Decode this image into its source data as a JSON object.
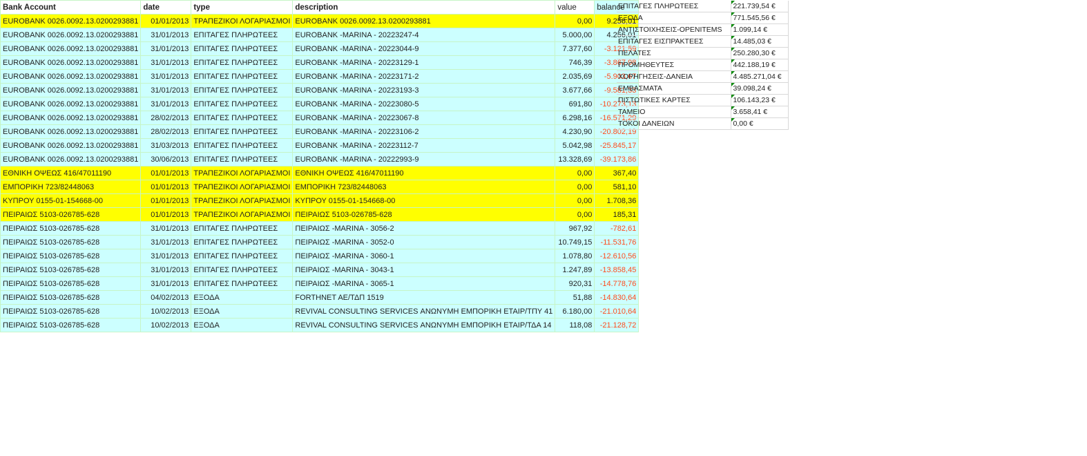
{
  "headers": {
    "account": "Bank Account",
    "date": "date",
    "type": "type",
    "description": "description",
    "value": "value",
    "balance": "balance"
  },
  "rows": [
    {
      "account": "EUROBANK 0026.0092.13.0200293881",
      "date": "01/01/2013",
      "type": "ΤΡΑΠΕΖΙΚΟΙ ΛΟΓΑΡΙΑΣΜΟΙ",
      "description": "EUROBANK 0026.0092.13.0200293881",
      "value": "0,00",
      "balance": "9.256,01",
      "highlight": true
    },
    {
      "account": "EUROBANK 0026.0092.13.0200293881",
      "date": "31/01/2013",
      "type": "ΕΠΙΤΑΓΕΣ ΠΛΗΡΩΤΕΕΣ",
      "description": "EUROBANK -MARINA - 20223247-4",
      "value": "5.000,00",
      "balance": "4.256,01"
    },
    {
      "account": "EUROBANK 0026.0092.13.0200293881",
      "date": "31/01/2013",
      "type": "ΕΠΙΤΑΓΕΣ ΠΛΗΡΩΤΕΕΣ",
      "description": "EUROBANK -MARINA - 20223044-9",
      "value": "7.377,60",
      "balance": "-3.121,59"
    },
    {
      "account": "EUROBANK 0026.0092.13.0200293881",
      "date": "31/01/2013",
      "type": "ΕΠΙΤΑΓΕΣ ΠΛΗΡΩΤΕΕΣ",
      "description": "EUROBANK -MARINA - 20223129-1",
      "value": "746,39",
      "balance": "-3.867,98"
    },
    {
      "account": "EUROBANK 0026.0092.13.0200293881",
      "date": "31/01/2013",
      "type": "ΕΠΙΤΑΓΕΣ ΠΛΗΡΩΤΕΕΣ",
      "description": "EUROBANK -MARINA - 20223171-2",
      "value": "2.035,69",
      "balance": "-5.903,67"
    },
    {
      "account": "EUROBANK 0026.0092.13.0200293881",
      "date": "31/01/2013",
      "type": "ΕΠΙΤΑΓΕΣ ΠΛΗΡΩΤΕΕΣ",
      "description": "EUROBANK -MARINA - 20223193-3",
      "value": "3.677,66",
      "balance": "-9.581,33"
    },
    {
      "account": "EUROBANK 0026.0092.13.0200293881",
      "date": "31/01/2013",
      "type": "ΕΠΙΤΑΓΕΣ ΠΛΗΡΩΤΕΕΣ",
      "description": "EUROBANK -MARINA - 20223080-5",
      "value": "691,80",
      "balance": "-10.273,13"
    },
    {
      "account": "EUROBANK 0026.0092.13.0200293881",
      "date": "28/02/2013",
      "type": "ΕΠΙΤΑΓΕΣ ΠΛΗΡΩΤΕΕΣ",
      "description": "EUROBANK -MARINA - 20223067-8",
      "value": "6.298,16",
      "balance": "-16.571,29"
    },
    {
      "account": "EUROBANK 0026.0092.13.0200293881",
      "date": "28/02/2013",
      "type": "ΕΠΙΤΑΓΕΣ ΠΛΗΡΩΤΕΕΣ",
      "description": "EUROBANK -MARINA - 20223106-2",
      "value": "4.230,90",
      "balance": "-20.802,19"
    },
    {
      "account": "EUROBANK 0026.0092.13.0200293881",
      "date": "31/03/2013",
      "type": "ΕΠΙΤΑΓΕΣ ΠΛΗΡΩΤΕΕΣ",
      "description": "EUROBANK -MARINA - 20223112-7",
      "value": "5.042,98",
      "balance": "-25.845,17"
    },
    {
      "account": "EUROBANK 0026.0092.13.0200293881",
      "date": "30/06/2013",
      "type": "ΕΠΙΤΑΓΕΣ ΠΛΗΡΩΤΕΕΣ",
      "description": "EUROBANK -MARINA - 20222993-9",
      "value": "13.328,69",
      "balance": "-39.173,86"
    },
    {
      "account": "ΕΘΝΙΚΗ ΟΨΕΩΣ 416/47011190",
      "date": "01/01/2013",
      "type": "ΤΡΑΠΕΖΙΚΟΙ ΛΟΓΑΡΙΑΣΜΟΙ",
      "description": "ΕΘΝΙΚΗ ΟΨΕΩΣ 416/47011190",
      "value": "0,00",
      "balance": "367,40",
      "highlight": true
    },
    {
      "account": "ΕΜΠΟΡΙΚΗ 723/82448063",
      "date": "01/01/2013",
      "type": "ΤΡΑΠΕΖΙΚΟΙ ΛΟΓΑΡΙΑΣΜΟΙ",
      "description": "ΕΜΠΟΡΙΚΗ 723/82448063",
      "value": "0,00",
      "balance": "581,10",
      "highlight": true
    },
    {
      "account": "ΚΥΠΡΟΥ 0155-01-154668-00",
      "date": "01/01/2013",
      "type": "ΤΡΑΠΕΖΙΚΟΙ ΛΟΓΑΡΙΑΣΜΟΙ",
      "description": "ΚΥΠΡΟΥ 0155-01-154668-00",
      "value": "0,00",
      "balance": "1.708,36",
      "highlight": true
    },
    {
      "account": "ΠΕΙΡΑΙΩΣ 5103-026785-628",
      "date": "01/01/2013",
      "type": "ΤΡΑΠΕΖΙΚΟΙ ΛΟΓΑΡΙΑΣΜΟΙ",
      "description": "ΠΕΙΡΑΙΩΣ 5103-026785-628",
      "value": "0,00",
      "balance": "185,31",
      "highlight": true
    },
    {
      "account": "ΠΕΙΡΑΙΩΣ 5103-026785-628",
      "date": "31/01/2013",
      "type": "ΕΠΙΤΑΓΕΣ ΠΛΗΡΩΤΕΕΣ",
      "description": "ΠΕΙΡΑΙΩΣ -MARINA - 3056-2",
      "value": "967,92",
      "balance": "-782,61"
    },
    {
      "account": "ΠΕΙΡΑΙΩΣ 5103-026785-628",
      "date": "31/01/2013",
      "type": "ΕΠΙΤΑΓΕΣ ΠΛΗΡΩΤΕΕΣ",
      "description": "ΠΕΙΡΑΙΩΣ -MARINA - 3052-0",
      "value": "10.749,15",
      "balance": "-11.531,76"
    },
    {
      "account": "ΠΕΙΡΑΙΩΣ 5103-026785-628",
      "date": "31/01/2013",
      "type": "ΕΠΙΤΑΓΕΣ ΠΛΗΡΩΤΕΕΣ",
      "description": "ΠΕΙΡΑΙΩΣ -MARINA - 3060-1",
      "value": "1.078,80",
      "balance": "-12.610,56"
    },
    {
      "account": "ΠΕΙΡΑΙΩΣ 5103-026785-628",
      "date": "31/01/2013",
      "type": "ΕΠΙΤΑΓΕΣ ΠΛΗΡΩΤΕΕΣ",
      "description": "ΠΕΙΡΑΙΩΣ -MARINA - 3043-1",
      "value": "1.247,89",
      "balance": "-13.858,45"
    },
    {
      "account": "ΠΕΙΡΑΙΩΣ 5103-026785-628",
      "date": "31/01/2013",
      "type": "ΕΠΙΤΑΓΕΣ ΠΛΗΡΩΤΕΕΣ",
      "description": "ΠΕΙΡΑΙΩΣ -MARINA - 3065-1",
      "value": "920,31",
      "balance": "-14.778,76"
    },
    {
      "account": "ΠΕΙΡΑΙΩΣ 5103-026785-628",
      "date": "04/02/2013",
      "type": "ΕΞΟΔΑ",
      "description": "FORTHNET AE/ΤΔΠ 1519",
      "value": "51,88",
      "balance": "-14.830,64"
    },
    {
      "account": "ΠΕΙΡΑΙΩΣ 5103-026785-628",
      "date": "10/02/2013",
      "type": "ΕΞΟΔΑ",
      "description": "REVIVAL CONSULTING SERVICES ΑΝΩΝΥΜΗ ΕΜΠΟΡΙΚΗ ΕΤΑΙΡ/ΤΠΥ 41",
      "value": "6.180,00",
      "balance": "-21.010,64"
    },
    {
      "account": "ΠΕΙΡΑΙΩΣ 5103-026785-628",
      "date": "10/02/2013",
      "type": "ΕΞΟΔΑ",
      "description": "REVIVAL CONSULTING SERVICES ΑΝΩΝΥΜΗ ΕΜΠΟΡΙΚΗ ΕΤΑΙΡ/ΤΔΑ 14",
      "value": "118,08",
      "balance": "-21.128,72"
    }
  ],
  "summary": [
    {
      "label": "ΕΠΙΤΑΓΕΣ ΠΛΗΡΩΤΕΕΣ",
      "value": "221.739,54 €"
    },
    {
      "label": "ΕΞΟΔΑ",
      "value": "771.545,56 €"
    },
    {
      "label": "ΑΝΤΙΣΤΟΙΧΗΣΕΙΣ-OPENITEMS",
      "value": "1.099,14 €"
    },
    {
      "label": "ΕΠΙΤΑΓΕΣ ΕΙΣΠΡΑΚΤΕΕΣ",
      "value": "14.485,03 €"
    },
    {
      "label": "ΠΕΛΑΤΕΣ",
      "value": "250.280,30 €"
    },
    {
      "label": "ΠΡΟΜΗΘΕΥΤΕΣ",
      "value": "442.188,19 €"
    },
    {
      "label": "ΧΟΡΗΓΗΣΕΙΣ-ΔΑΝΕΙΑ",
      "value": "4.485.271,04 €"
    },
    {
      "label": "ΕΜΒΑΣΜΑΤΑ",
      "value": "39.098,24 €"
    },
    {
      "label": "ΠΙΣΤΩΤΙΚΕΣ ΚΑΡΤΕΣ",
      "value": "106.143,23 €"
    },
    {
      "label": "ΤΑΜΕΙΟ",
      "value": "3.658,41 €"
    },
    {
      "label": "ΤΟΚΟΙ ΔΑΝΕΙΩΝ",
      "value": "0,00 €"
    }
  ],
  "colors": {
    "highlight": "#ffff00",
    "row": "#ccffff",
    "negative": "#ff4a1c"
  }
}
